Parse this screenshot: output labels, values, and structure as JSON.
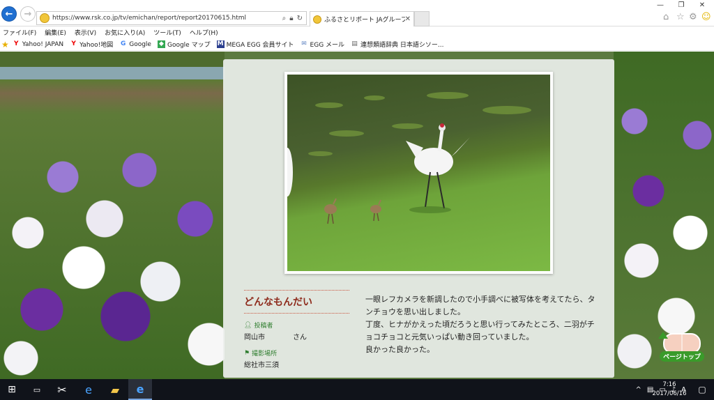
{
  "browser": {
    "url": "https://www.rsk.co.jp/tv/emichan/report/report20170615.html",
    "tab_title": "ふるさとリポート JAグループ岡山...",
    "menu": [
      "ファイル(F)",
      "編集(E)",
      "表示(V)",
      "お気に入り(A)",
      "ツール(T)",
      "ヘルプ(H)"
    ],
    "favorites": [
      {
        "label": "Yahoo! JAPAN",
        "icon": "yahoo-icon"
      },
      {
        "label": "Yahoo!地図",
        "icon": "yahoo-icon"
      },
      {
        "label": "Google",
        "icon": "google-icon"
      },
      {
        "label": "Google マップ",
        "icon": "google-maps-icon"
      },
      {
        "label": "MEGA EGG 会員サイト",
        "icon": "megaegg-icon"
      },
      {
        "label": "EGG メール",
        "icon": "mail-icon"
      },
      {
        "label": "連想類語辞典 日本語シソー...",
        "icon": "page-icon"
      }
    ]
  },
  "article": {
    "title": "どんなもんだい",
    "poster_label": "投稿者",
    "poster_value": "岡山市　　　　さん",
    "location_label": "撮影場所",
    "location_value": "総社市三須",
    "body": [
      "一眼レフカメラを新調したので小手調べに被写体を考えてたら、タンチョウを思い出しました。",
      "丁度、ヒナがかえった頃だろうと思い行ってみたところ、二羽がチョコチョコと元気いっぱい動き回っていました。",
      "良かった良かった。"
    ],
    "page_top": "ページトップ"
  },
  "taskbar": {
    "time": "7:16",
    "date": "2017/06/16",
    "ime": "A"
  },
  "colors": {
    "title": "#8e2b1c",
    "label_green": "#2e7d2e",
    "accent_blue": "#1f6fd1"
  }
}
